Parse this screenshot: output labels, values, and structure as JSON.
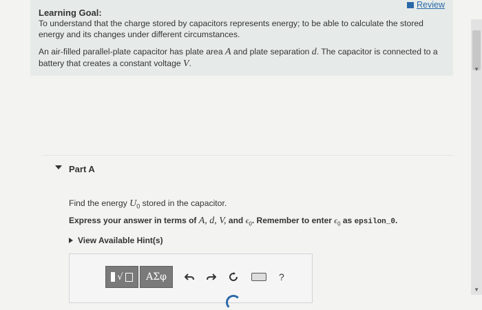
{
  "review_link": "Review",
  "learning_goal": {
    "title": "Learning Goal:",
    "text": "To understand that the charge stored by capacitors represents energy; to be able to calculate the stored energy and its changes under different circumstances."
  },
  "problem": {
    "part1": "An air-filled parallel-plate capacitor has plate area ",
    "A": "A",
    "part2": " and plate separation ",
    "d": "d",
    "part3": ". The capacitor is connected to a battery that creates a constant voltage ",
    "V": "V",
    "part4": "."
  },
  "part_a": {
    "title": "Part A",
    "question_pre": "Find the energy ",
    "U0": "U",
    "U0_sub": "0",
    "question_post": " stored in the capacitor.",
    "instruct_pre": "Express your answer in terms of ",
    "vars": "A, d, V,",
    "and": " and ",
    "eps": "ϵ",
    "eps_sub": "0",
    "instruct_mid": ". Remember to enter ",
    "eps2": "ϵ",
    "eps2_sub": "0",
    "as": " as ",
    "code": "epsilon_0",
    "instruct_end": ".",
    "hints": "View Available Hint(s)"
  },
  "toolbar": {
    "greek": "ΑΣφ",
    "help": "?"
  },
  "icons": [
    "book-icon",
    "undo-icon",
    "redo-icon",
    "reset-icon",
    "keyboard-icon",
    "help-icon"
  ]
}
